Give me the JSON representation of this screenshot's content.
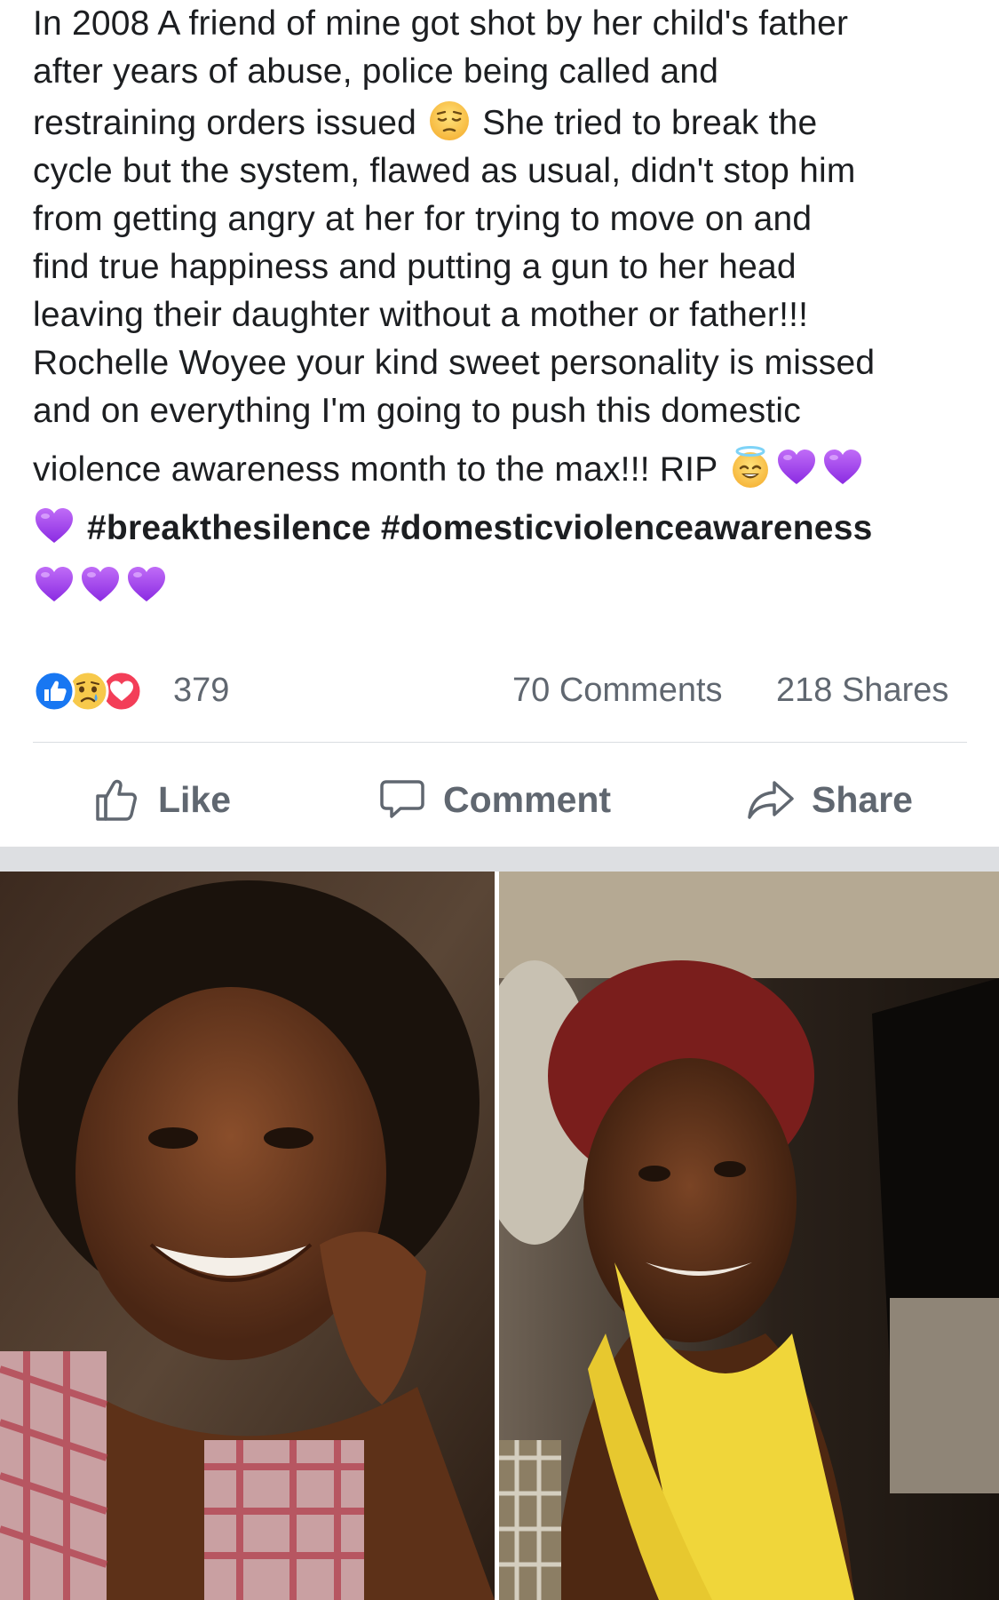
{
  "post": {
    "text_lines": [
      "In 2008 A friend of mine got shot by her child's father",
      "after years of abuse, police being called and",
      "restraining orders issued",
      "She tried to break the",
      "cycle but the system, flawed as usual, didn't stop him",
      "from getting angry at her for trying to move on and",
      "find true happiness and putting a gun to her head",
      "leaving their daughter without a mother or father!!!",
      "Rochelle Woyee your kind sweet personality is missed",
      "and on everything I'm going to push this domestic",
      "violence awareness month to the max!!! RIP"
    ],
    "hashtags": [
      "#breakthesilence",
      "#domesticviolenceawareness"
    ],
    "emojis": {
      "pensive": "pensive-face-emoji",
      "halo": "smiling-face-with-halo-emoji",
      "heart": "purple-heart-emoji"
    }
  },
  "stats": {
    "reaction_count": "379",
    "comments": "70 Comments",
    "shares": "218 Shares",
    "reaction_types": [
      "like-reaction-icon",
      "sad-reaction-icon",
      "love-reaction-icon"
    ]
  },
  "actions": {
    "like": "Like",
    "comment": "Comment",
    "share": "Share"
  },
  "colors": {
    "text": "#1c1e21",
    "secondary_text": "#606770",
    "divider": "#dadde1",
    "separator": "#dddfe2",
    "like_blue": "#1877f2",
    "love_red": "#f33e58",
    "purple_heart": "#9b34e8"
  }
}
